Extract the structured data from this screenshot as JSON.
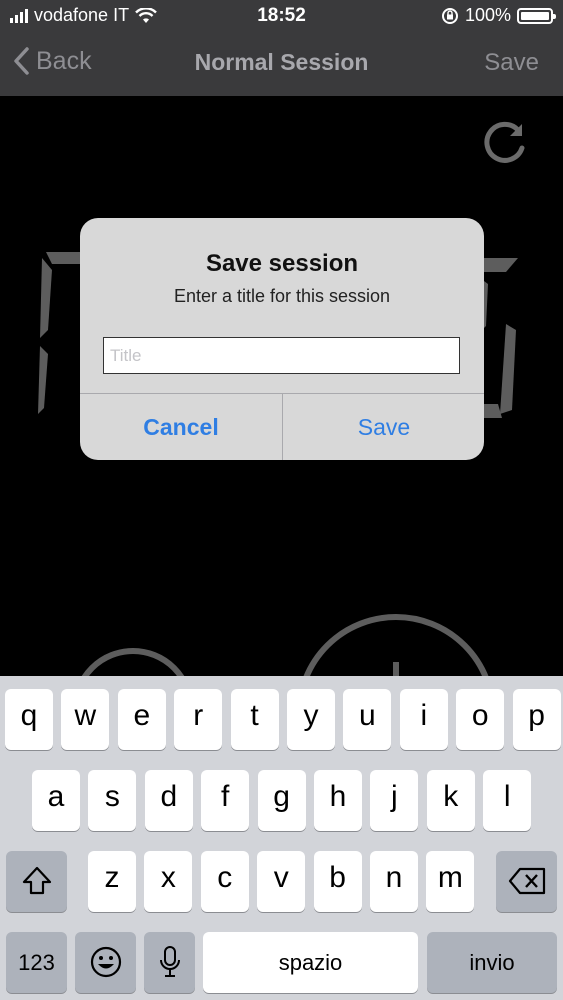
{
  "status_bar": {
    "carrier": "vodafone IT",
    "time": "18:52",
    "battery": "100%",
    "battery_level": 1.0,
    "icons": [
      "signal-icon",
      "wifi-icon",
      "orientation-lock-icon",
      "battery-icon"
    ]
  },
  "nav": {
    "back_label": "Back",
    "title": "Normal Session",
    "save_label": "Save"
  },
  "dialog": {
    "title": "Save session",
    "message": "Enter a title for this session",
    "input_value": "",
    "input_placeholder": "Title",
    "cancel_label": "Cancel",
    "save_label": "Save"
  },
  "keyboard": {
    "row1": [
      "q",
      "w",
      "e",
      "r",
      "t",
      "y",
      "u",
      "i",
      "o",
      "p"
    ],
    "row2": [
      "a",
      "s",
      "d",
      "f",
      "g",
      "h",
      "j",
      "k",
      "l"
    ],
    "row3": [
      "z",
      "x",
      "c",
      "v",
      "b",
      "n",
      "m"
    ],
    "numbers_label": "123",
    "space_label": "spazio",
    "return_label": "invio"
  },
  "colors": {
    "accent": "#2f7ee3",
    "nav_bg": "#3a3a3c",
    "keyboard_bg": "#d2d4d9"
  }
}
